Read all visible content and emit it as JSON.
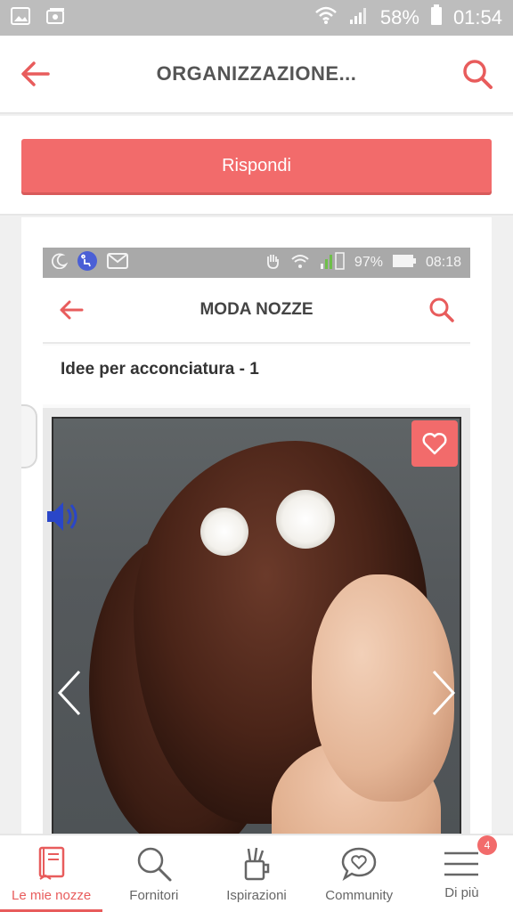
{
  "status_bar": {
    "battery_percent": "58%",
    "time": "01:54"
  },
  "header": {
    "title": "ORGANIZZAZIONE..."
  },
  "reply": {
    "label": "Rispondi"
  },
  "embedded_screenshot": {
    "status_bar": {
      "battery_percent": "97%",
      "time": "08:18"
    },
    "header": {
      "title": "MODA NOZZE"
    },
    "gallery_title": "Idee per acconciatura - 1"
  },
  "bottom_nav": {
    "items": [
      {
        "label": "Le mie nozze",
        "icon": "book-icon",
        "active": true
      },
      {
        "label": "Fornitori",
        "icon": "search-icon",
        "active": false
      },
      {
        "label": "Ispirazioni",
        "icon": "pencil-cup-icon",
        "active": false
      },
      {
        "label": "Community",
        "icon": "heart-bubble-icon",
        "active": false
      },
      {
        "label": "Di più",
        "icon": "menu-icon",
        "active": false,
        "badge": "4"
      }
    ]
  },
  "colors": {
    "accent": "#f26b6b",
    "status_bar": "#bdbdbd",
    "text": "#555555"
  }
}
